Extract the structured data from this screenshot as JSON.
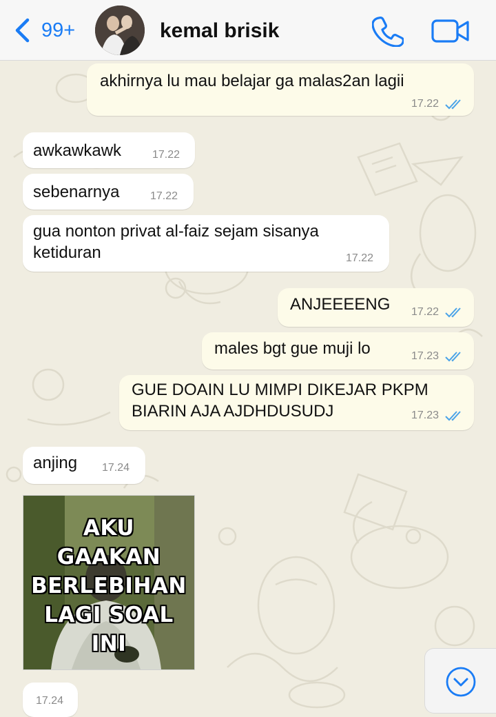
{
  "header": {
    "back_count": "99+",
    "contact_name": "kemal brisik",
    "accent_color": "#1a7cf5",
    "icons": {
      "back": "chevron-left-icon",
      "call": "phone-icon",
      "video": "video-camera-icon"
    }
  },
  "messages": [
    {
      "direction": "outgoing",
      "text": "akhirnya lu mau belajar ga malas2an lagii",
      "time": "17.22",
      "read": true
    },
    {
      "direction": "incoming",
      "text": "awkawkawk",
      "time": "17.22"
    },
    {
      "direction": "incoming",
      "text": "sebenarnya",
      "time": "17.22"
    },
    {
      "direction": "incoming",
      "text": "gua nonton privat al-faiz sejam sisanya\nketiduran",
      "time": "17.22"
    },
    {
      "direction": "outgoing",
      "text": "ANJEEEENG",
      "time": "17.22",
      "read": true
    },
    {
      "direction": "outgoing",
      "text": "males bgt gue muji lo",
      "time": "17.23",
      "read": true
    },
    {
      "direction": "outgoing",
      "text": "GUE DOAIN LU MIMPI DIKEJAR PKPM\nBIARIN AJA AJDHDUSUDJ",
      "time": "17.23",
      "read": true
    },
    {
      "direction": "incoming",
      "text": "anjing",
      "time": "17.24"
    }
  ],
  "media": {
    "caption_lines": [
      "AKU",
      "GAAKAN",
      "BERLEBIHAN",
      "LAGI SOAL",
      "INI"
    ]
  },
  "last_time": "17.24",
  "scroll_icon": "chevron-down-circle-icon",
  "colors": {
    "outgoing_bubble": "#fdfbe9",
    "incoming_bubble": "#ffffff",
    "read_ticks": "#4aa3e8"
  }
}
